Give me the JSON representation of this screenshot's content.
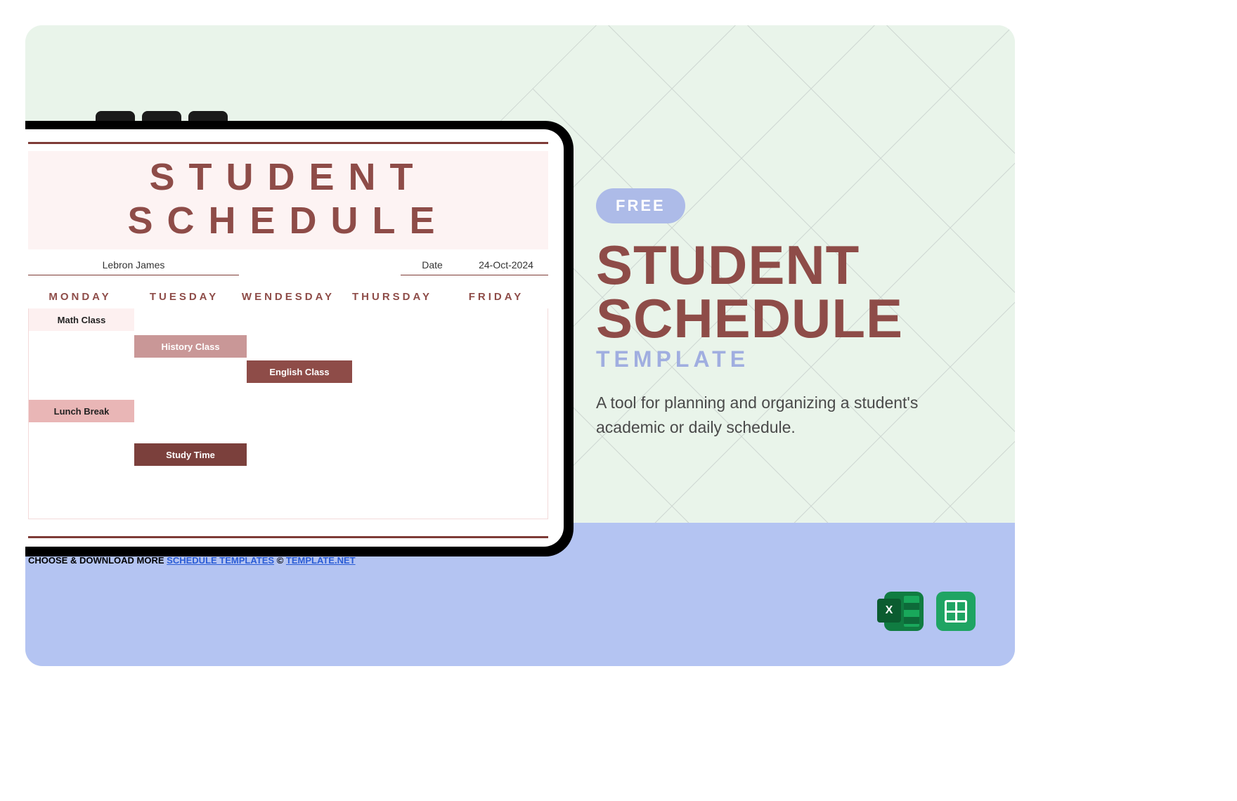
{
  "right": {
    "badge": "FREE",
    "title_line1": "STUDENT",
    "title_line2": "SCHEDULE",
    "template_word": "TEMPLATE",
    "description": "A tool for planning and organizing a student's academic or daily schedule."
  },
  "screen": {
    "title": "STUDENT SCHEDULE",
    "student_name": "Lebron James",
    "date_label": "Date",
    "date_value": "24-Oct-2024",
    "days": [
      "MONDAY",
      "TUESDAY",
      "WENDESDAY",
      "THURSDAY",
      "FRIDAY"
    ],
    "blocks": {
      "math": "Math Class",
      "history": "History Class",
      "english": "English Class",
      "lunch": "Lunch Break",
      "study": "Study Time"
    },
    "download_prefix": "CHOOSE & DOWNLOAD MORE ",
    "download_link": "SCHEDULE TEMPLATES",
    "copyright_prefix": " © ",
    "copyright_link": " TEMPLATE.NET"
  },
  "icons": {
    "excel": "excel-icon",
    "sheets": "google-sheets-icon"
  }
}
